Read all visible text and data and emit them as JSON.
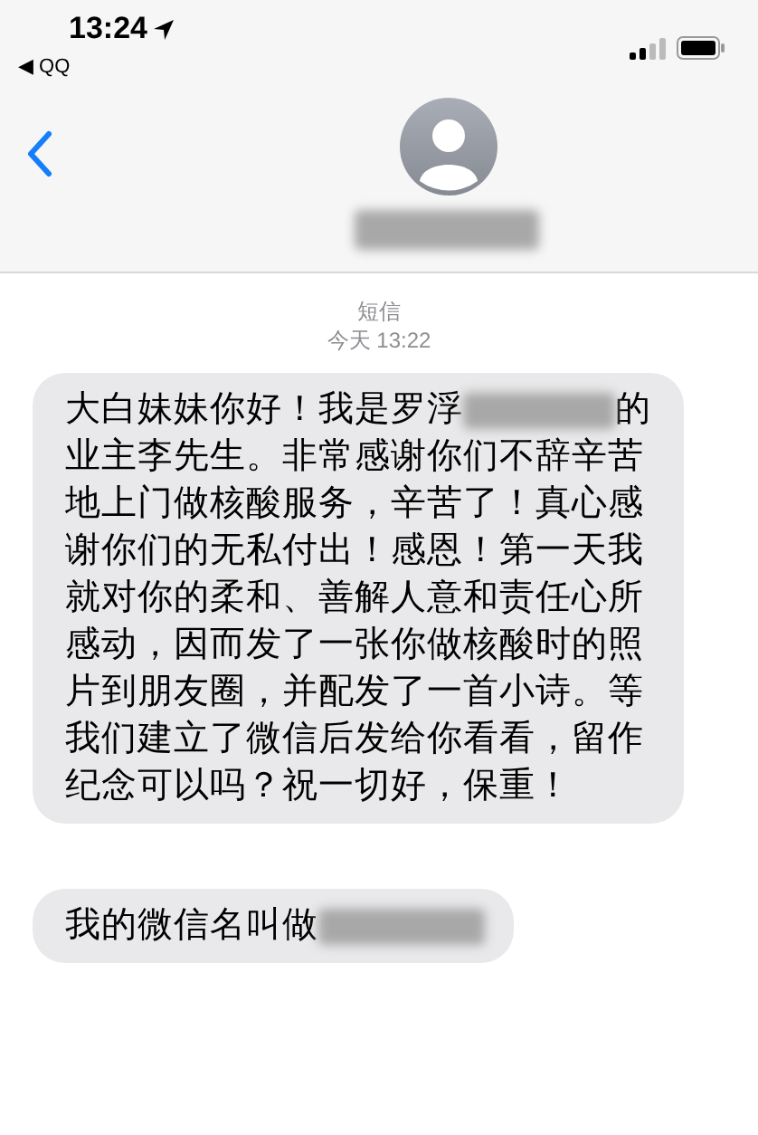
{
  "status_bar": {
    "time": "13:24",
    "back_app": "◀ QQ"
  },
  "header": {
    "contact_name": {
      "kind": "redacted"
    }
  },
  "thread": {
    "service": "短信",
    "timestamp": "今天 13:22"
  },
  "messages": [
    {
      "segments": [
        {
          "kind": "text",
          "text": "大白妹妹你好！我是罗浮"
        },
        {
          "kind": "redacted"
        },
        {
          "kind": "text",
          "text": "的业主李先生。非常感谢你们不辞辛苦地上门做核酸服务，辛苦了！真心感谢你们的无私付出！感恩！第一天我就对你的柔和、善解人意和责任心所感动，因而发了一张你做核酸时的照片到朋友圈，并配发了一首小诗。等我们建立了微信后发给你看看，留作纪念可以吗？祝一切好，保重！"
        }
      ]
    },
    {
      "segments": [
        {
          "kind": "text",
          "text": "我的微信名叫做"
        },
        {
          "kind": "redacted"
        }
      ]
    }
  ]
}
